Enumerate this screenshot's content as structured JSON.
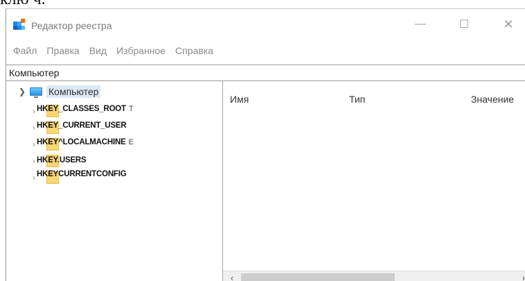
{
  "caption": "клю ч.",
  "window": {
    "title": "Редактор реестра",
    "controls": {
      "minimize": "—",
      "maximize": "☐",
      "close": "✕"
    }
  },
  "menu": [
    "Файл",
    "Правка",
    "Вид",
    "Избранное",
    "Справка"
  ],
  "address": "Компьютер",
  "tree": {
    "root": "Компьютер",
    "hives": [
      "HKEY_CLASSES_ROOT",
      "HKEY_CURRENT_USER",
      "HKEY^LOCALMACHINE",
      "HKEY.USERS",
      "HKEYCURRENTCONFIG"
    ],
    "hive_marks": [
      "T",
      "",
      "E",
      "",
      ""
    ]
  },
  "columns": [
    "Имя",
    "Тип",
    "Значение"
  ],
  "icons": {
    "app": "registry-editor-icon",
    "expand": "chevron-down-icon",
    "collapse": "chevron-right-icon",
    "computer": "computer-icon",
    "folder": "folder-icon"
  },
  "colors": {
    "folder": "#f7d774",
    "selection": "#dde8f3",
    "computer": "#2a92e0"
  }
}
